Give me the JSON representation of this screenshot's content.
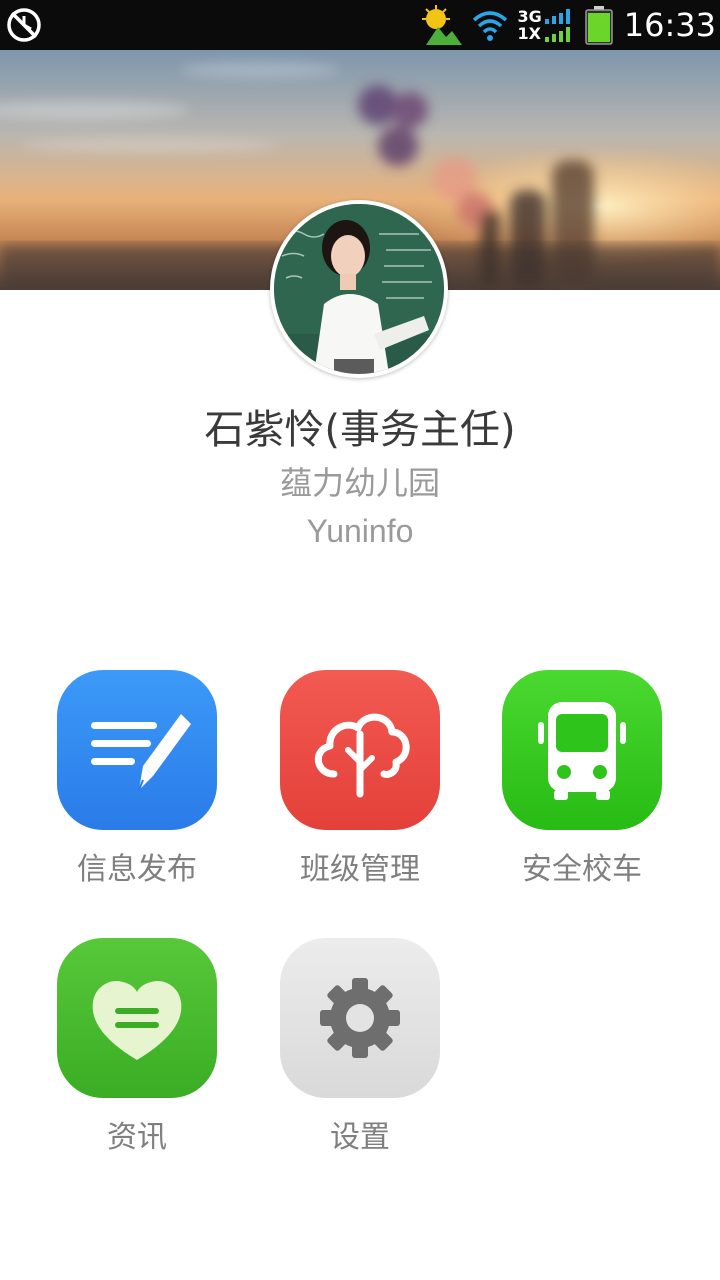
{
  "status_bar": {
    "time": "16:33",
    "network_top": "3G",
    "network_bottom": "1X",
    "icons": [
      "alarm-off-icon",
      "photo-notification-icon",
      "wifi-icon",
      "signal-icon",
      "battery-icon"
    ]
  },
  "profile": {
    "name": "石紫怜(事务主任)",
    "school": "蕴力幼儿园",
    "organization": "Yuninfo"
  },
  "apps": [
    {
      "label": "信息发布",
      "icon": "edit-message-icon",
      "color": "#2f86f2"
    },
    {
      "label": "班级管理",
      "icon": "tree-cloud-icon",
      "color": "#eb4a43"
    },
    {
      "label": "安全校车",
      "icon": "bus-icon",
      "color": "#36c61e"
    },
    {
      "label": "资讯",
      "icon": "heart-note-icon",
      "color": "#49b82c"
    },
    {
      "label": "设置",
      "icon": "gear-icon",
      "color": "#e2e2e2"
    }
  ]
}
